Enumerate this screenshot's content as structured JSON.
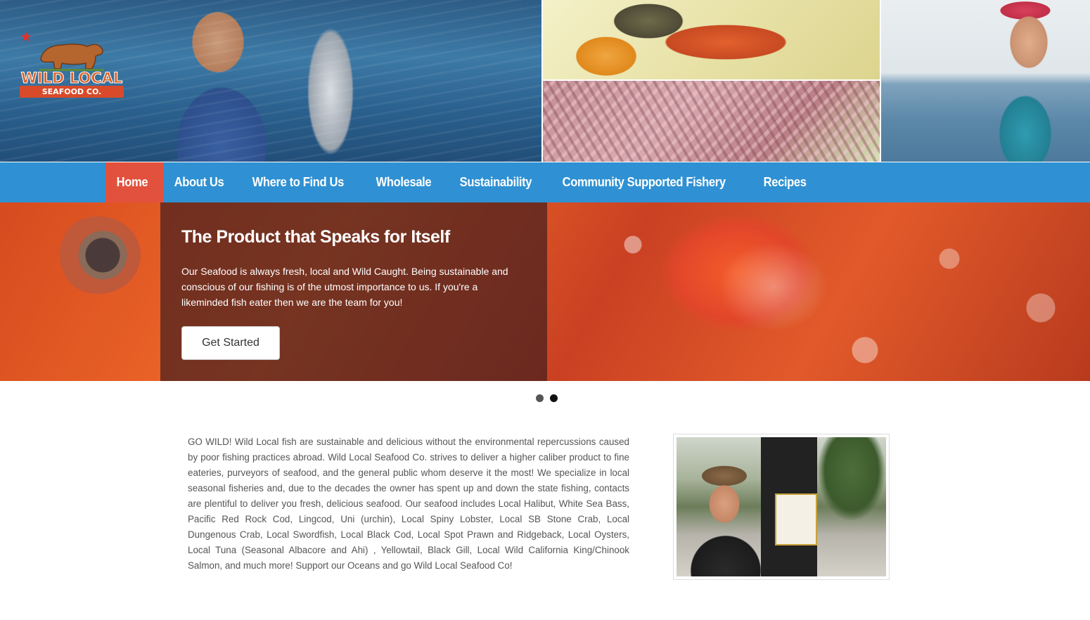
{
  "logo": {
    "title": "WILD LOCAL",
    "subtitle": "SEAFOOD CO."
  },
  "nav": {
    "items": [
      {
        "label": "Home",
        "active": true
      },
      {
        "label": "About Us",
        "active": false
      },
      {
        "label": "Where to Find Us",
        "active": false
      },
      {
        "label": "Wholesale",
        "active": false
      },
      {
        "label": "Sustainability",
        "active": false
      },
      {
        "label": "Community Supported Fishery",
        "active": false
      },
      {
        "label": "Recipes",
        "active": false
      }
    ]
  },
  "hero": {
    "title": "The Product that Speaks for Itself",
    "text": "Our Seafood is always fresh, local and Wild Caught. Being sustainable and conscious of our fishing is of the utmost importance to us. If you're a likeminded fish eater then we are the team for you!",
    "button_label": "Get Started"
  },
  "carousel": {
    "slide_count": 2,
    "active_index": 1
  },
  "about": {
    "text": "GO WILD! Wild Local fish are sustainable and delicious without the environmental repercussions caused by poor fishing practices abroad. Wild Local Seafood Co. strives to deliver a higher caliber product to fine eateries, purveyors of seafood, and the general public whom deserve it the most! We specialize in local seasonal fisheries and, due to the decades the owner has spent up and down the state fishing, contacts are plentiful to deliver you fresh, delicious seafood. Our seafood includes Local Halibut, White Sea Bass, Pacific Red Rock Cod, Lingcod, Uni (urchin), Local Spiny Lobster, Local SB Stone Crab, Local Dungenous Crab, Local Swordfish, Local Black Cod, Local Spot Prawn and Ridgeback, Local Oysters, Local Tuna (Seasonal Albacore and Ahi) , Yellowtail, Black Gill, Local Wild California King/Chinook Salmon, and much more! Support our Oceans and go Wild Local Seafood Co!"
  },
  "colors": {
    "nav_bg": "#2f91d3",
    "nav_active": "#e2513d",
    "hero_panel": "#461e1e",
    "logo_orange": "#d8632a"
  },
  "icons": {
    "logo_star": "red-star-icon",
    "logo_bear": "bear-icon"
  }
}
